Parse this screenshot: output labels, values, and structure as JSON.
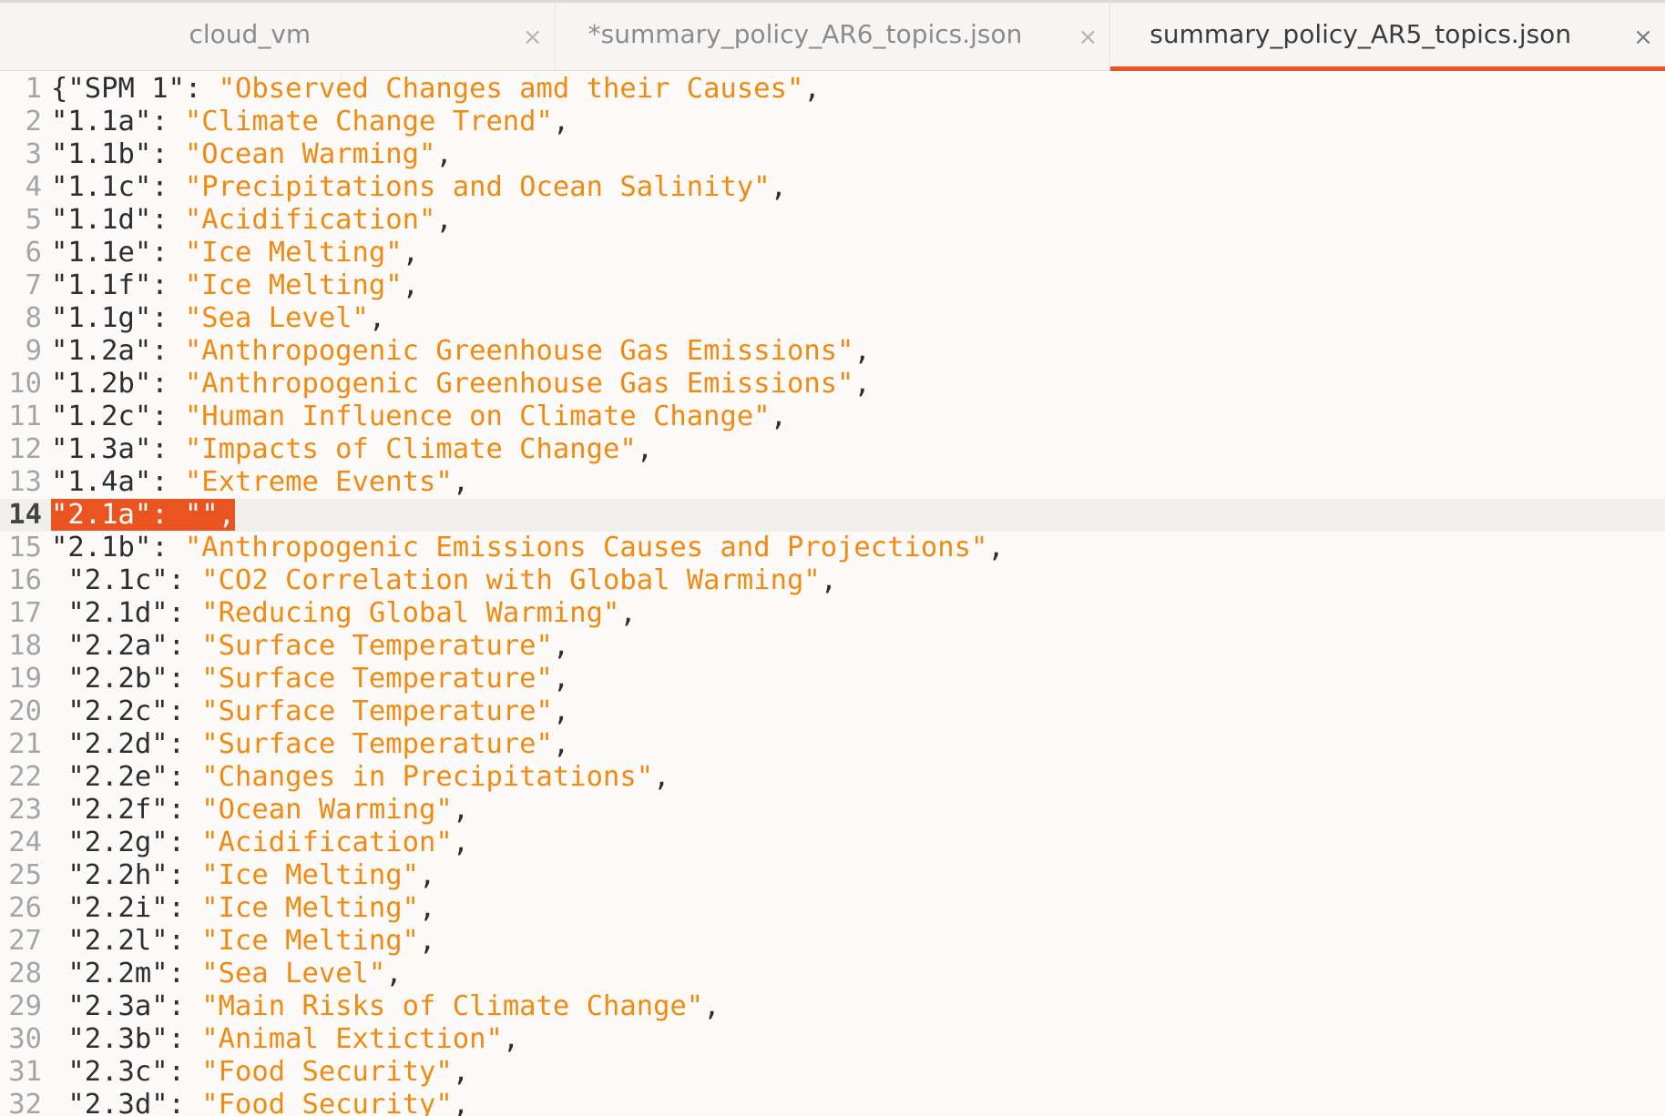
{
  "tabs": [
    {
      "label": "cloud_vm",
      "active": false
    },
    {
      "label": "*summary_policy_AR6_topics.json",
      "active": false
    },
    {
      "label": "summary_policy_AR5_topics.json",
      "active": true
    }
  ],
  "close_glyph": "×",
  "colors": {
    "accent": "#e95420",
    "string": "#f08a10",
    "text": "#2e2e2e",
    "line_number": "#a5a5a5"
  },
  "editor": {
    "current_line": 14,
    "lines": [
      {
        "n": "1",
        "indent": "",
        "prefix": "{",
        "key": "\"SPM 1\"",
        "sep": ": ",
        "value": "\"Observed Changes amd their Causes\"",
        "end": ","
      },
      {
        "n": "2",
        "indent": "",
        "prefix": "",
        "key": "\"1.1a\"",
        "sep": ": ",
        "value": "\"Climate Change Trend\"",
        "end": ","
      },
      {
        "n": "3",
        "indent": "",
        "prefix": "",
        "key": "\"1.1b\"",
        "sep": ": ",
        "value": "\"Ocean Warming\"",
        "end": ","
      },
      {
        "n": "4",
        "indent": "",
        "prefix": "",
        "key": "\"1.1c\"",
        "sep": ": ",
        "value": "\"Precipitations and Ocean Salinity\"",
        "end": ","
      },
      {
        "n": "5",
        "indent": "",
        "prefix": "",
        "key": "\"1.1d\"",
        "sep": ": ",
        "value": "\"Acidification\"",
        "end": ","
      },
      {
        "n": "6",
        "indent": "",
        "prefix": "",
        "key": "\"1.1e\"",
        "sep": ": ",
        "value": "\"Ice Melting\"",
        "end": ","
      },
      {
        "n": "7",
        "indent": "",
        "prefix": "",
        "key": "\"1.1f\"",
        "sep": ": ",
        "value": "\"Ice Melting\"",
        "end": ","
      },
      {
        "n": "8",
        "indent": "",
        "prefix": "",
        "key": "\"1.1g\"",
        "sep": ": ",
        "value": "\"Sea Level\"",
        "end": ","
      },
      {
        "n": "9",
        "indent": "",
        "prefix": "",
        "key": "\"1.2a\"",
        "sep": ": ",
        "value": "\"Anthropogenic Greenhouse Gas Emissions\"",
        "end": ","
      },
      {
        "n": "10",
        "indent": "",
        "prefix": "",
        "key": "\"1.2b\"",
        "sep": ": ",
        "value": "\"Anthropogenic Greenhouse Gas Emissions\"",
        "end": ","
      },
      {
        "n": "11",
        "indent": "",
        "prefix": "",
        "key": "\"1.2c\"",
        "sep": ": ",
        "value": "\"Human Influence on Climate Change\"",
        "end": ","
      },
      {
        "n": "12",
        "indent": "",
        "prefix": "",
        "key": "\"1.3a\"",
        "sep": ": ",
        "value": "\"Impacts of Climate Change\"",
        "end": ","
      },
      {
        "n": "13",
        "indent": "",
        "prefix": "",
        "key": "\"1.4a\"",
        "sep": ": ",
        "value": "\"Extreme Events\"",
        "end": ","
      },
      {
        "n": "14",
        "indent": "",
        "prefix": "",
        "key": "\"2.1a\"",
        "sep": ": ",
        "value": "\"\"",
        "end": ",",
        "selected": true
      },
      {
        "n": "15",
        "indent": "",
        "prefix": "",
        "key": "\"2.1b\"",
        "sep": ": ",
        "value": "\"Anthropogenic Emissions Causes and Projections\"",
        "end": ","
      },
      {
        "n": "16",
        "indent": " ",
        "prefix": "",
        "key": "\"2.1c\"",
        "sep": ": ",
        "value": "\"CO2 Correlation with Global Warming\"",
        "end": ","
      },
      {
        "n": "17",
        "indent": " ",
        "prefix": "",
        "key": "\"2.1d\"",
        "sep": ": ",
        "value": "\"Reducing Global Warming\"",
        "end": ","
      },
      {
        "n": "18",
        "indent": " ",
        "prefix": "",
        "key": "\"2.2a\"",
        "sep": ": ",
        "value": "\"Surface Temperature\"",
        "end": ","
      },
      {
        "n": "19",
        "indent": " ",
        "prefix": "",
        "key": "\"2.2b\"",
        "sep": ": ",
        "value": "\"Surface Temperature\"",
        "end": ","
      },
      {
        "n": "20",
        "indent": " ",
        "prefix": "",
        "key": "\"2.2c\"",
        "sep": ": ",
        "value": "\"Surface Temperature\"",
        "end": ","
      },
      {
        "n": "21",
        "indent": " ",
        "prefix": "",
        "key": "\"2.2d\"",
        "sep": ": ",
        "value": "\"Surface Temperature\"",
        "end": ","
      },
      {
        "n": "22",
        "indent": " ",
        "prefix": "",
        "key": "\"2.2e\"",
        "sep": ": ",
        "value": "\"Changes in Precipitations\"",
        "end": ","
      },
      {
        "n": "23",
        "indent": " ",
        "prefix": "",
        "key": "\"2.2f\"",
        "sep": ": ",
        "value": "\"Ocean Warming\"",
        "end": ","
      },
      {
        "n": "24",
        "indent": " ",
        "prefix": "",
        "key": "\"2.2g\"",
        "sep": ": ",
        "value": "\"Acidification\"",
        "end": ","
      },
      {
        "n": "25",
        "indent": " ",
        "prefix": "",
        "key": "\"2.2h\"",
        "sep": ": ",
        "value": "\"Ice Melting\"",
        "end": ","
      },
      {
        "n": "26",
        "indent": " ",
        "prefix": "",
        "key": "\"2.2i\"",
        "sep": ": ",
        "value": "\"Ice Melting\"",
        "end": ","
      },
      {
        "n": "27",
        "indent": " ",
        "prefix": "",
        "key": "\"2.2l\"",
        "sep": ": ",
        "value": "\"Ice Melting\"",
        "end": ","
      },
      {
        "n": "28",
        "indent": " ",
        "prefix": "",
        "key": "\"2.2m\"",
        "sep": ": ",
        "value": "\"Sea Level\"",
        "end": ","
      },
      {
        "n": "29",
        "indent": " ",
        "prefix": "",
        "key": "\"2.3a\"",
        "sep": ": ",
        "value": "\"Main Risks of Climate Change\"",
        "end": ","
      },
      {
        "n": "30",
        "indent": " ",
        "prefix": "",
        "key": "\"2.3b\"",
        "sep": ": ",
        "value": "\"Animal Extiction\"",
        "end": ","
      },
      {
        "n": "31",
        "indent": " ",
        "prefix": "",
        "key": "\"2.3c\"",
        "sep": ": ",
        "value": "\"Food Security\"",
        "end": ","
      },
      {
        "n": "32",
        "indent": " ",
        "prefix": "",
        "key": "\"2.3d\"",
        "sep": ": ",
        "value": "\"Food Security\"",
        "end": ","
      }
    ]
  }
}
